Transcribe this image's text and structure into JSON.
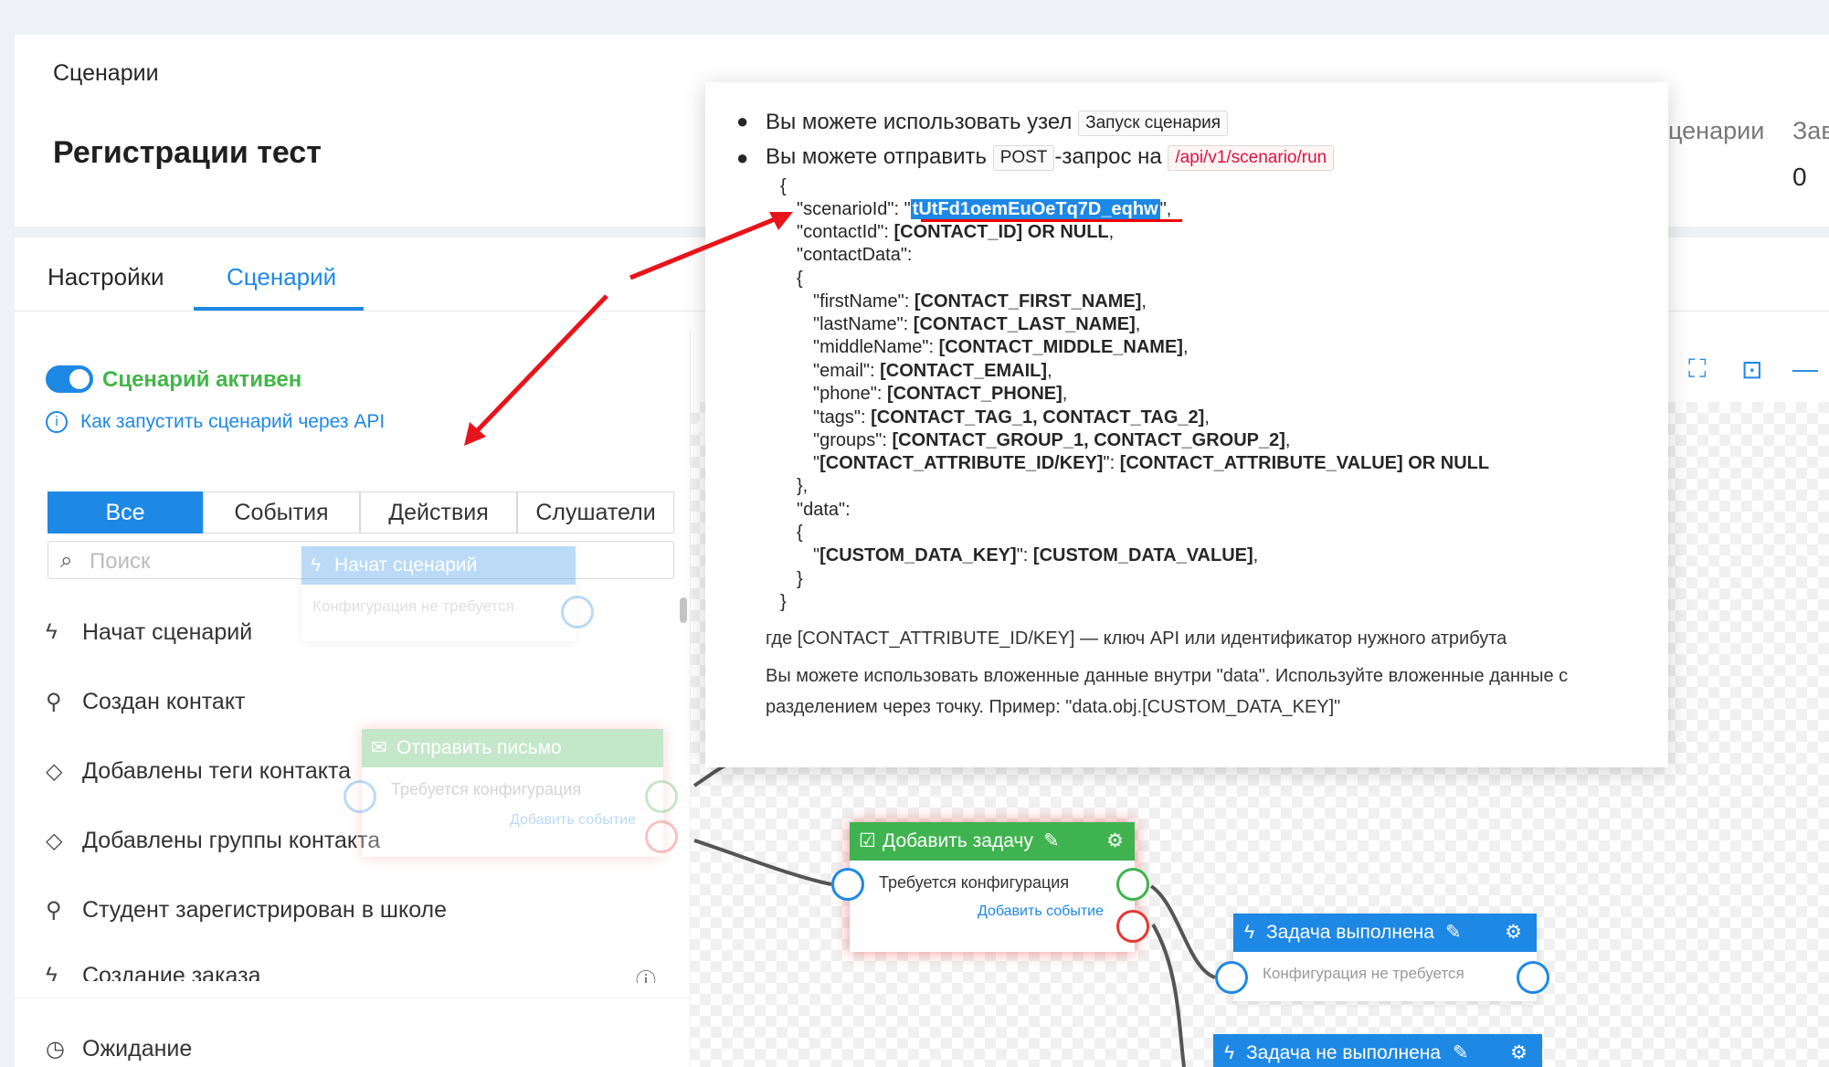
{
  "header": {
    "breadcrumb": "Сценарии",
    "title": "Регистрации тест",
    "stat1_label": "ценарии",
    "stat2_label": "Зав",
    "stat2_value": "0"
  },
  "tabs": {
    "settings": "Настройки",
    "scenario": "Сценарий"
  },
  "panel": {
    "active_label": "Сценарий активен",
    "api_link": "Как запустить сценарий через API",
    "filters": [
      "Все",
      "События",
      "Действия",
      "Слушатели"
    ],
    "search_placeholder": "Поиск",
    "items": [
      "Начат сценарий",
      "Создан контакт",
      "Добавлены теги контакта",
      "Добавлены группы контакта",
      "Студент зарегистрирован в школе",
      "Создание заказа",
      "Ожидание"
    ]
  },
  "ghost": {
    "start_title": "Начат сценарий",
    "start_sub": "Конфигурация не требуется",
    "mail_title": "Отправить письмо",
    "mail_sub": "Требуется конфигурация",
    "mail_link": "Добавить событие"
  },
  "nodes": {
    "task_title": "Добавить задачу",
    "task_sub": "Требуется конфигурация",
    "task_link": "Добавить событие",
    "done_title": "Задача выполнена",
    "done_sub": "Конфигурация не требуется",
    "notdone_title": "Задача не выполнена"
  },
  "popup": {
    "line1_text": "Вы можете использовать узел",
    "line1_tag": "Запуск сценария",
    "line2_text": "Вы можете отправить",
    "line2_tag": "POST",
    "line2_mid": "-запрос на",
    "line2_url": "/api/v1/scenario/run",
    "open": "{",
    "sid_key": "\"scenarioId\": \"",
    "sid_val": "tUtFd1oemEuOeTq7D_eqhw",
    "sid_end": "\",",
    "cid_key": "\"contactId\": ",
    "cid_val": "[CONTACT_ID] OR NULL",
    "cid_end": ",",
    "cdata_key": "\"contactData\":",
    "open2": "{",
    "fn_key": "\"firstName\": ",
    "fn_val": "[CONTACT_FIRST_NAME]",
    "ln_key": "\"lastName\": ",
    "ln_val": "[CONTACT_LAST_NAME]",
    "mn_key": "\"middleName\": ",
    "mn_val": "[CONTACT_MIDDLE_NAME]",
    "em_key": "\"email\": ",
    "em_val": "[CONTACT_EMAIL]",
    "ph_key": "\"phone\": ",
    "ph_val": "[CONTACT_PHONE]",
    "tg_key": "\"tags\": ",
    "tg_val": "[CONTACT_TAG_1, CONTACT_TAG_2]",
    "gr_key": "\"groups\": ",
    "gr_val": "[CONTACT_GROUP_1, CONTACT_GROUP_2]",
    "at_key": "\"",
    "at_keyb": "[CONTACT_ATTRIBUTE_ID/KEY]",
    "at_mid": "\": ",
    "at_val": "[CONTACT_ATTRIBUTE_VALUE] OR NULL",
    "close2": "},",
    "data_key": "\"data\":",
    "open3": "{",
    "cd_pre": "\"",
    "cd_key": "[CUSTOM_DATA_KEY]",
    "cd_mid": "\": ",
    "cd_val": "[CUSTOM_DATA_VALUE]",
    "cd_end": ",",
    "close3": "}",
    "close": "}",
    "note1": "где [CONTACT_ATTRIBUTE_ID/KEY] — ключ API или идентификатор нужного атрибута",
    "note2": "Вы можете использовать вложенные данные внутри \"data\". Используйте вложенные данные с",
    "note3": "разделением через точку. Пример: \"data.obj.[CUSTOM_DATA_KEY]\""
  },
  "colors": {
    "accent": "#1e88e5",
    "active_green": "#43b649",
    "node_green": "#3fb34f",
    "error_red": "#e53935",
    "arrow": "#e8141b"
  },
  "icons": [
    "bolt-icon",
    "user-icon",
    "tag-icon",
    "clock-icon",
    "info-icon",
    "search-icon",
    "gear-icon",
    "edit-icon",
    "check-square-icon",
    "fullscreen-icon",
    "fit-icon",
    "minus-icon"
  ]
}
